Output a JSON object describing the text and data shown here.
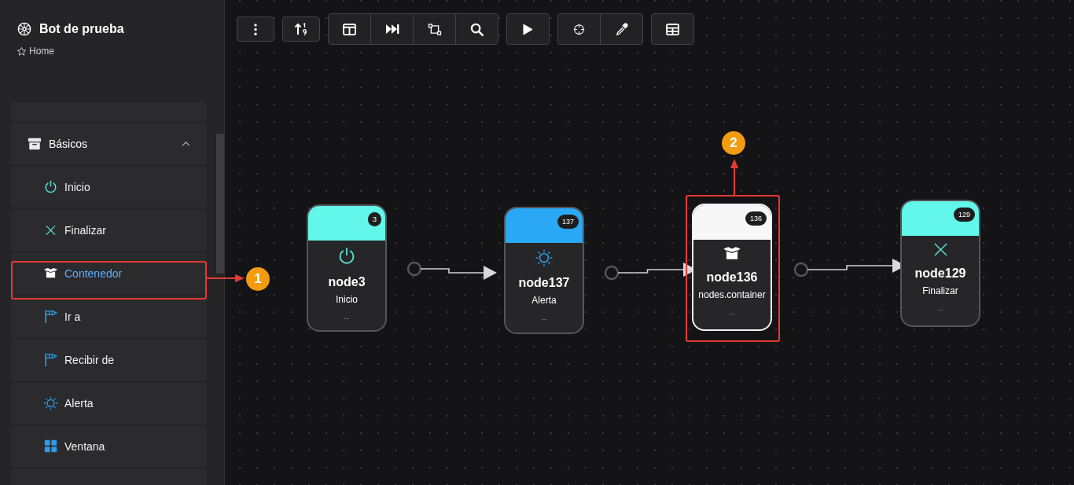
{
  "project": {
    "title": "Bot de prueba",
    "breadcrumb": "Home"
  },
  "sidebar": {
    "group": {
      "label": "Básicos",
      "expanded": true
    },
    "items": [
      {
        "label": "Inicio",
        "kind": "power",
        "selected": false
      },
      {
        "label": "Finalizar",
        "kind": "cross",
        "selected": false
      },
      {
        "label": "Contenedor",
        "kind": "box",
        "selected": true
      },
      {
        "label": "Ir a",
        "kind": "flag",
        "selected": false
      },
      {
        "label": "Recibir de",
        "kind": "flag",
        "selected": false
      },
      {
        "label": "Alerta",
        "kind": "sun",
        "selected": false
      },
      {
        "label": "Ventana",
        "kind": "grid",
        "selected": false
      }
    ]
  },
  "toolbar": [
    {
      "buttons": [
        {
          "kind": "more"
        }
      ]
    },
    {
      "buttons": [
        {
          "kind": "sort"
        }
      ]
    },
    {
      "buttons": [
        {
          "kind": "columns"
        },
        {
          "kind": "skip"
        },
        {
          "kind": "layout"
        },
        {
          "kind": "search"
        }
      ]
    },
    {
      "buttons": [
        {
          "kind": "play"
        }
      ]
    },
    {
      "buttons": [
        {
          "kind": "target"
        },
        {
          "kind": "picker"
        }
      ]
    },
    {
      "buttons": [
        {
          "kind": "table"
        }
      ]
    }
  ],
  "nodes": [
    {
      "name": "node3",
      "label": "Inicio",
      "badge": "3",
      "kind": "power",
      "color": "#62f7ea",
      "selected": false,
      "footer": "..."
    },
    {
      "name": "node137",
      "label": "Alerta",
      "badge": "137",
      "kind": "sun",
      "color": "#2aa8f5",
      "selected": false,
      "footer": "..."
    },
    {
      "name": "node136",
      "label": "nodes.container",
      "badge": "136",
      "kind": "box",
      "color": "#f7f7f7",
      "selected": true,
      "footer": "..."
    },
    {
      "name": "node129",
      "label": "Finalizar",
      "badge": "129",
      "kind": "cross",
      "color": "#62f7ea",
      "selected": false,
      "footer": "..."
    }
  ],
  "callouts": [
    {
      "number": "1"
    },
    {
      "number": "2"
    }
  ]
}
